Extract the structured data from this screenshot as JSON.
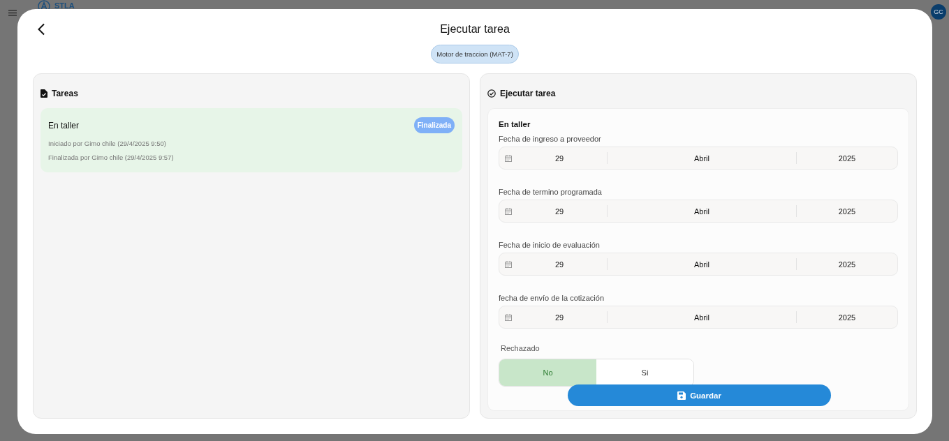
{
  "app_bar": {
    "logo_text": "STLA",
    "avatar": "GC"
  },
  "dialog": {
    "title": "Ejecutar tarea",
    "chip": "Motor de traccion (MAT-7)"
  },
  "tasks_panel": {
    "title": "Tareas",
    "tasks": [
      {
        "name": "En taller",
        "status": "Finalizada",
        "lines": [
          "Iniciado por Gimo chile (29/4/2025 9:50)",
          "Finalizada por Gimo chile (29/4/2025 9:57)"
        ]
      }
    ]
  },
  "execute_panel": {
    "title": "Ejecutar tarea",
    "task_name": "En taller",
    "date_fields": [
      {
        "label": "Fecha de ingreso a proveedor",
        "day": "29",
        "month": "Abril",
        "year": "2025"
      },
      {
        "label": "Fecha de termino programada",
        "day": "29",
        "month": "Abril",
        "year": "2025"
      },
      {
        "label": "Fecha de inicio de evaluación",
        "day": "29",
        "month": "Abril",
        "year": "2025"
      },
      {
        "label": "fecha de envío de la cotización",
        "day": "29",
        "month": "Abril",
        "year": "2025"
      }
    ],
    "rejected": {
      "label": "Rechazado",
      "options": [
        {
          "label": "No",
          "selected": true
        },
        {
          "label": "Si",
          "selected": false
        }
      ]
    },
    "save_button": "Guardar"
  }
}
